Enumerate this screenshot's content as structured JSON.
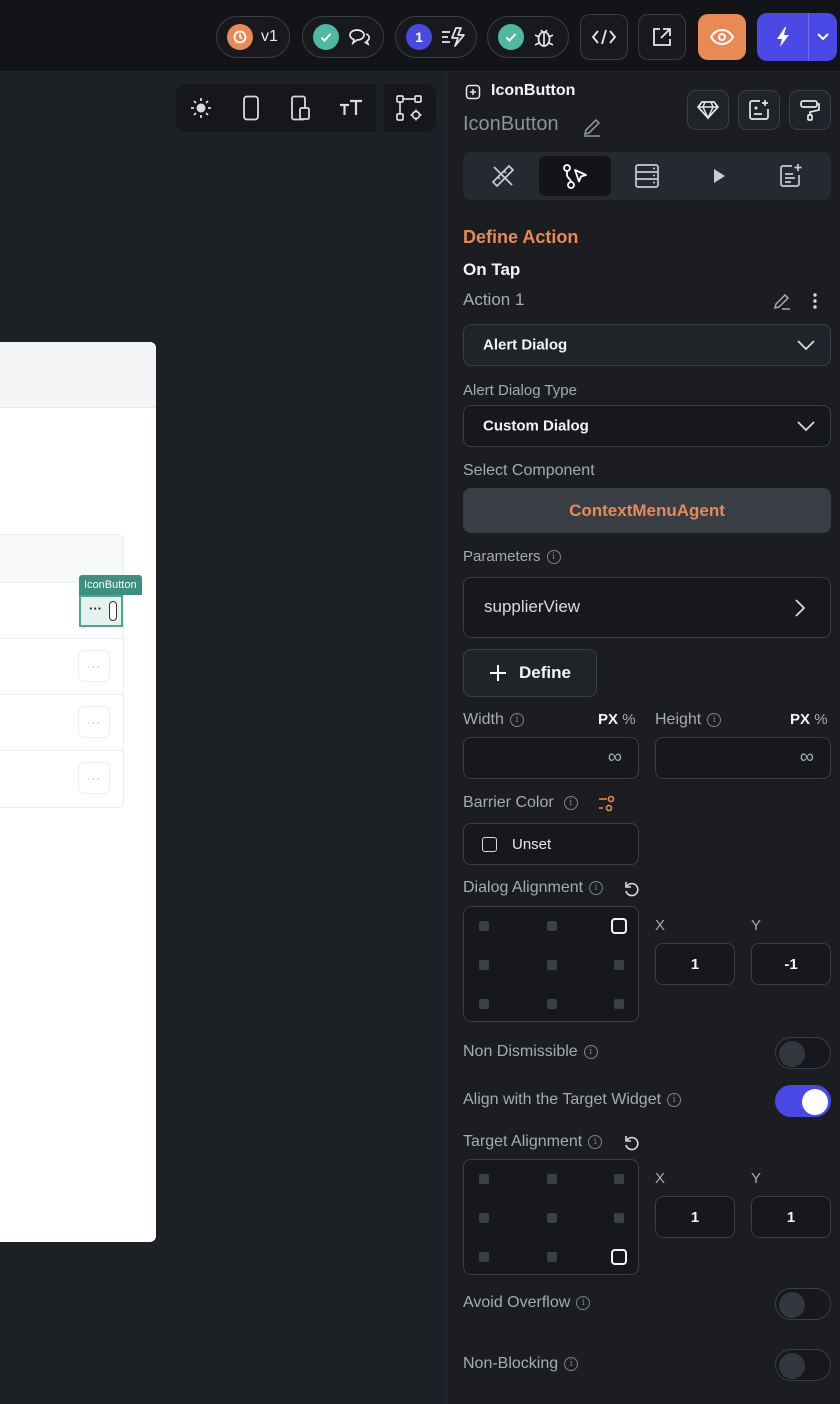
{
  "topbar": {
    "version_label": "v1",
    "notification_count": "1"
  },
  "canvas": {
    "selected_widget_tag": "IconButton",
    "row_button_glyph": "···"
  },
  "panel": {
    "widget_type": "IconButton",
    "widget_name": "IconButton",
    "define_action_label": "Define Action",
    "trigger_label": "On Tap",
    "action_name": "Action 1",
    "action_type": "Alert Dialog",
    "alert_dialog_type_label": "Alert Dialog Type",
    "alert_dialog_type_value": "Custom Dialog",
    "select_component_label": "Select Component",
    "component_value": "ContextMenuAgent",
    "parameters_label": "Parameters",
    "parameter_item": "supplierView",
    "define_button": "Define",
    "width_label": "Width",
    "height_label": "Height",
    "unit_px": "PX",
    "unit_pct": "%",
    "width_value": "∞",
    "height_value": "∞",
    "barrier_color_label": "Barrier Color",
    "barrier_color_value": "Unset",
    "dialog_alignment_label": "Dialog Alignment",
    "dialog_alignment": {
      "x_label": "X",
      "y_label": "Y",
      "x": "1",
      "y": "-1"
    },
    "non_dismissible_label": "Non Dismissible",
    "non_dismissible": false,
    "align_target_label": "Align with the Target Widget",
    "align_target": true,
    "target_alignment_label": "Target Alignment",
    "target_alignment": {
      "x_label": "X",
      "y_label": "Y",
      "x": "1",
      "y": "1"
    },
    "avoid_overflow_label": "Avoid Overflow",
    "avoid_overflow": false,
    "non_blocking_label": "Non-Blocking",
    "non_blocking": false
  },
  "colors": {
    "accent_orange": "#e98a55",
    "accent_blue": "#4a49e6",
    "selection_teal": "#3d8f7f"
  }
}
